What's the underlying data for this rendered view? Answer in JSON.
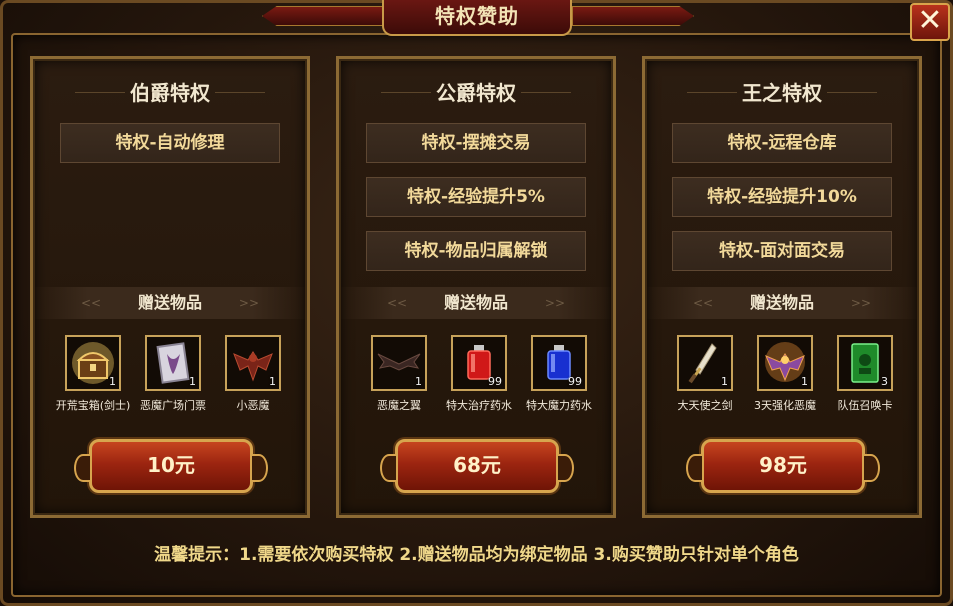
{
  "window": {
    "title": "特权赞助"
  },
  "panels": [
    {
      "title": "伯爵特权",
      "privileges": [
        "特权-自动修理"
      ],
      "gift_label": "赠送物品",
      "gift_arrow_left": "<<",
      "gift_arrow_right": ">>",
      "items": [
        {
          "name": "开荒宝箱(剑士)",
          "qty": "1",
          "icon": "treasure-chest-icon"
        },
        {
          "name": "恶魔广场门票",
          "qty": "1",
          "icon": "ticket-icon"
        },
        {
          "name": "小恶魔",
          "qty": "1",
          "icon": "imp-icon"
        }
      ],
      "price": "10元"
    },
    {
      "title": "公爵特权",
      "privileges": [
        "特权-摆摊交易",
        "特权-经验提升5%",
        "特权-物品归属解锁"
      ],
      "gift_label": "赠送物品",
      "gift_arrow_left": "<<",
      "gift_arrow_right": ">>",
      "items": [
        {
          "name": "恶魔之翼",
          "qty": "1",
          "icon": "demon-wings-icon"
        },
        {
          "name": "特大治疗药水",
          "qty": "99",
          "icon": "red-potion-icon"
        },
        {
          "name": "特大魔力药水",
          "qty": "99",
          "icon": "blue-potion-icon"
        }
      ],
      "price": "68元"
    },
    {
      "title": "王之特权",
      "privileges": [
        "特权-远程仓库",
        "特权-经验提升10%",
        "特权-面对面交易"
      ],
      "gift_label": "赠送物品",
      "gift_arrow_left": "<<",
      "gift_arrow_right": ">>",
      "items": [
        {
          "name": "大天使之剑",
          "qty": "1",
          "icon": "archangel-sword-icon"
        },
        {
          "name": "3天强化恶魔",
          "qty": "1",
          "icon": "enhanced-demon-icon"
        },
        {
          "name": "队伍召唤卡",
          "qty": "3",
          "icon": "summon-card-icon"
        }
      ],
      "price": "98元"
    }
  ],
  "close_glyph": "✕",
  "tip": "温馨提示：1.需要依次购买特权 2.赠送物品均为绑定物品 3.购买赞助只针对单个角色",
  "colors": {
    "accent_gold": "#c7a25a",
    "button_red": "#9c2510",
    "text_gold": "#f2d99a"
  }
}
